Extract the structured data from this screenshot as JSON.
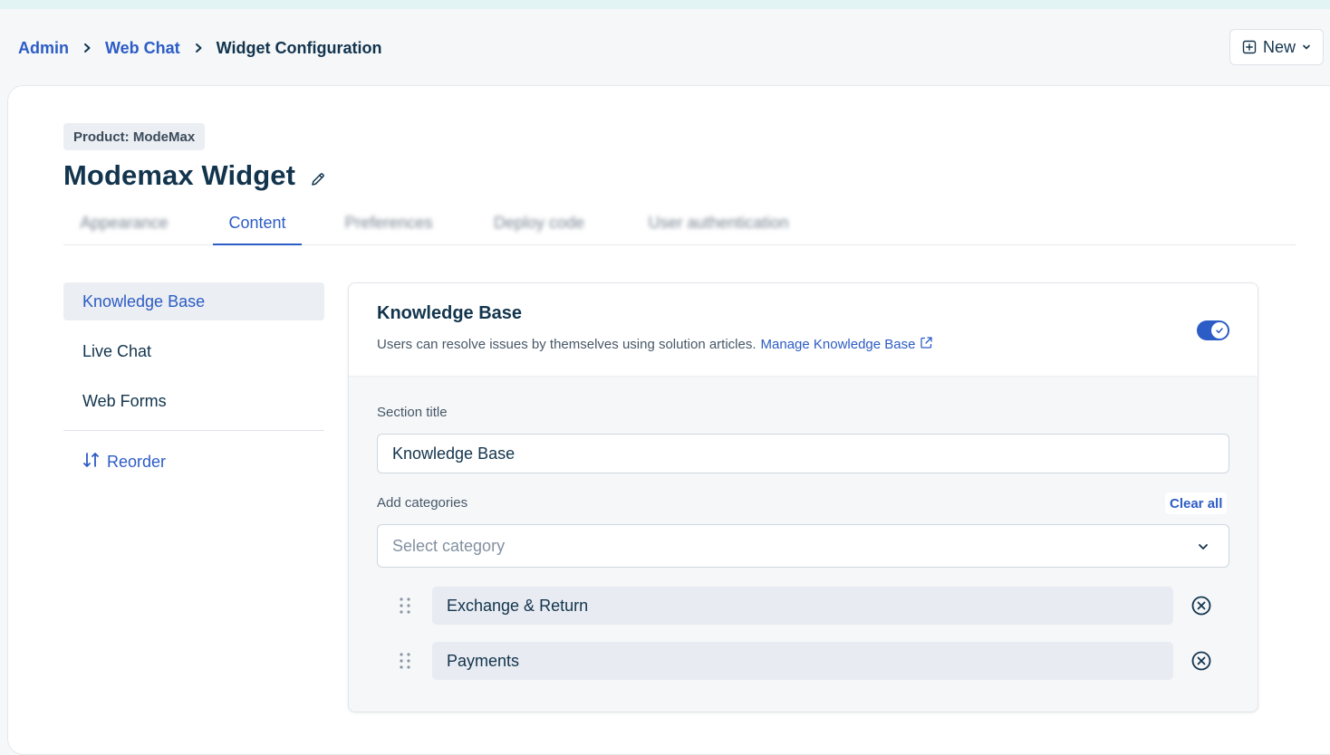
{
  "breadcrumb": {
    "items": [
      "Admin",
      "Web Chat"
    ],
    "current": "Widget Configuration"
  },
  "header": {
    "new_button": "New"
  },
  "product_badge": "Product: ModeMax",
  "page_title": "Modemax Widget",
  "tabs": [
    {
      "label": "Appearance",
      "blurred": true
    },
    {
      "label": "Content",
      "active": true
    },
    {
      "label": "Preferences",
      "blurred": true
    },
    {
      "label": "Deploy code",
      "blurred": true
    },
    {
      "label": "User authentication",
      "blurred": true
    }
  ],
  "sidebar": {
    "items": [
      {
        "label": "Knowledge Base",
        "active": true
      },
      {
        "label": "Live Chat"
      },
      {
        "label": "Web Forms"
      }
    ],
    "reorder": "Reorder"
  },
  "knowledge_base": {
    "title": "Knowledge Base",
    "description": "Users can resolve issues by themselves using solution articles.",
    "manage_link": "Manage Knowledge Base",
    "enabled": true,
    "section_title_label": "Section title",
    "section_title_value": "Knowledge Base",
    "add_categories_label": "Add categories",
    "clear_all": "Clear all",
    "select_placeholder": "Select category",
    "categories": [
      "Exchange & Return",
      "Payments"
    ]
  },
  "colors": {
    "accent": "#2c5cc5",
    "text": "#12344d",
    "chip_bg": "#e8ebf1"
  }
}
